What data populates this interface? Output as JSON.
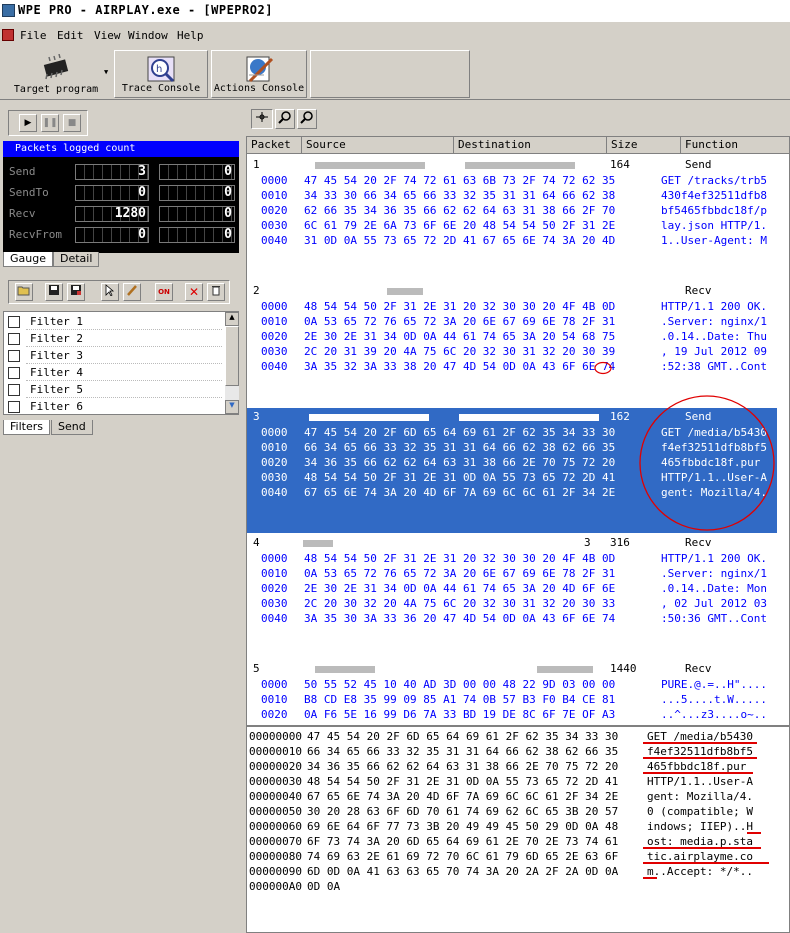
{
  "window": {
    "title": "WPE PRO - AIRPLAY.exe - [WPEPRO2]"
  },
  "menu": [
    "File",
    "Edit",
    "View",
    "Window",
    "Help"
  ],
  "toolbar": {
    "target_label": "Target program",
    "trace_label": "Trace Console",
    "actions_label": "Actions Console"
  },
  "stats": {
    "title": "Packets logged count",
    "rows": [
      {
        "label": "Send",
        "a": "3",
        "b": "0"
      },
      {
        "label": "SendTo",
        "a": "0",
        "b": "0"
      },
      {
        "label": "Recv",
        "a": "1280",
        "b": "0"
      },
      {
        "label": "RecvFrom",
        "a": "0",
        "b": "0"
      }
    ]
  },
  "tabs_top": [
    "Gauge",
    "Detail"
  ],
  "filters": [
    "Filter 1",
    "Filter 2",
    "Filter 3",
    "Filter 4",
    "Filter 5",
    "Filter 6"
  ],
  "tabs_bottom": [
    "Filters",
    "Send"
  ],
  "columns": [
    "Packet",
    "Source",
    "Destination",
    "Size",
    "Function"
  ],
  "packets": [
    {
      "num": "1",
      "size": "164",
      "func": "Send",
      "rows": [
        [
          "0000",
          "47 45 54 20 2F 74 72 61 63 6B 73 2F 74 72 62 35",
          "GET /tracks/trb5"
        ],
        [
          "0010",
          "34 33 30 66 34 65 66 33 32 35 31 31 64 66 62 38",
          "430f4ef32511dfb8"
        ],
        [
          "0020",
          "62 66 35 34 36 35 66 62 62 64 63 31 38 66 2F 70",
          "bf5465fbbdc18f/p"
        ],
        [
          "0030",
          "6C 61 79 2E 6A 73 6F 6E 20 48 54 54 50 2F 31 2E",
          "lay.json HTTP/1."
        ],
        [
          "0040",
          "31 0D 0A 55 73 65 72 2D 41 67 65 6E 74 3A 20 4D",
          "1..User-Agent: M"
        ]
      ]
    },
    {
      "num": "2",
      "size": "",
      "func": "Recv",
      "rows": [
        [
          "0000",
          "48 54 54 50 2F 31 2E 31 20 32 30 30 20 4F 4B 0D",
          "HTTP/1.1 200 OK."
        ],
        [
          "0010",
          "0A 53 65 72 76 65 72 3A 20 6E 67 69 6E 78 2F 31",
          ".Server: nginx/1"
        ],
        [
          "0020",
          "2E 30 2E 31 34 0D 0A 44 61 74 65 3A 20 54 68 75",
          ".0.14..Date: Thu"
        ],
        [
          "0030",
          "2C 20 31 39 20 4A 75 6C 20 32 30 31 32 20 30 39",
          ", 19 Jul 2012 09"
        ],
        [
          "0040",
          "3A 35 32 3A 33 38 20 47 4D 54 0D 0A 43 6F 6E 74",
          ":52:38 GMT..Cont"
        ]
      ]
    },
    {
      "num": "3",
      "size": "162",
      "func": "Send",
      "selected": true,
      "rows": [
        [
          "0000",
          "47 45 54 20 2F 6D 65 64 69 61 2F 62 35 34 33 30",
          "GET /media/b5430"
        ],
        [
          "0010",
          "66 34 65 66 33 32 35 31 31 64 66 62 38 62 66 35",
          "f4ef32511dfb8bf5"
        ],
        [
          "0020",
          "34 36 35 66 62 62 64 63 31 38 66 2E 70 75 72 20",
          "465fbbdc18f.pur "
        ],
        [
          "0030",
          "48 54 54 50 2F 31 2E 31 0D 0A 55 73 65 72 2D 41",
          "HTTP/1.1..User-A"
        ],
        [
          "0040",
          "67 65 6E 74 3A 20 4D 6F 7A 69 6C 6C 61 2F 34 2E",
          "gent: Mozilla/4."
        ]
      ]
    },
    {
      "num": "4",
      "size": "316",
      "func": "Recv",
      "size_prefix": "3",
      "rows": [
        [
          "0000",
          "48 54 54 50 2F 31 2E 31 20 32 30 30 20 4F 4B 0D",
          "HTTP/1.1 200 OK."
        ],
        [
          "0010",
          "0A 53 65 72 76 65 72 3A 20 6E 67 69 6E 78 2F 31",
          ".Server: nginx/1"
        ],
        [
          "0020",
          "2E 30 2E 31 34 0D 0A 44 61 74 65 3A 20 4D 6F 6E",
          ".0.14..Date: Mon"
        ],
        [
          "0030",
          "2C 20 30 32 20 4A 75 6C 20 32 30 31 32 20 30 33",
          ", 02 Jul 2012 03"
        ],
        [
          "0040",
          "3A 35 30 3A 33 36 20 47 4D 54 0D 0A 43 6F 6E 74",
          ":50:36 GMT..Cont"
        ]
      ]
    },
    {
      "num": "5",
      "size": "1440",
      "func": "Recv",
      "rows": [
        [
          "0000",
          "50 55 52 45 10 40 AD 3D 00 00 48 22 9D 03 00 00",
          "PURE.@.=..H\"...."
        ],
        [
          "0010",
          "B8 CD E8 35 99 09 85 A1 74 0B 57 B3 F0 B4 CE 81",
          "...5....t.W....."
        ],
        [
          "0020",
          "0A F6 5E 16 99 D6 7A 33 BD 19 DE 8C 6F 7E OF A3",
          "..^...z3....o~.."
        ]
      ]
    }
  ],
  "dump": [
    [
      "00000000",
      "47 45 54 20 2F 6D 65 64 69 61 2F 62 35 34 33 30",
      "GET /media/b5430"
    ],
    [
      "00000010",
      "66 34 65 66 33 32 35 31 31 64 66 62 38 62 66 35",
      "f4ef32511dfb8bf5"
    ],
    [
      "00000020",
      "34 36 35 66 62 62 64 63 31 38 66 2E 70 75 72 20",
      "465fbbdc18f.pur "
    ],
    [
      "00000030",
      "48 54 54 50 2F 31 2E 31 0D 0A 55 73 65 72 2D 41",
      "HTTP/1.1..User-A"
    ],
    [
      "00000040",
      "67 65 6E 74 3A 20 4D 6F 7A 69 6C 6C 61 2F 34 2E",
      "gent: Mozilla/4."
    ],
    [
      "00000050",
      "30 20 28 63 6F 6D 70 61 74 69 62 6C 65 3B 20 57",
      "0 (compatible; W"
    ],
    [
      "00000060",
      "69 6E 64 6F 77 73 3B 20 49 49 45 50 29 0D 0A 48",
      "indows; IIEP)..H"
    ],
    [
      "00000070",
      "6F 73 74 3A 20 6D 65 64 69 61 2E 70 2E 73 74 61",
      "ost: media.p.sta"
    ],
    [
      "00000080",
      "74 69 63 2E 61 69 72 70 6C 61 79 6D 65 2E 63 6F",
      "tic.airplayme.co"
    ],
    [
      "00000090",
      "6D 0D 0A 41 63 63 65 70 74 3A 20 2A 2F 2A 0D 0A",
      "m..Accept: */*.."
    ],
    [
      "000000A0",
      "0D 0A",
      ""
    ]
  ],
  "colors": {
    "selection": "#316ac5",
    "hex_text": "#0000ff",
    "annotation": "#e00000",
    "face": "#d4d0c8"
  },
  "icons": [
    "app-icon",
    "chip-icon",
    "trace-icon",
    "actions-icon",
    "play-icon",
    "pause-icon",
    "stop-icon",
    "open-icon",
    "save-icon",
    "save-as-icon",
    "cursor-icon",
    "edit-icon",
    "on-icon",
    "delete-icon",
    "trash-icon",
    "filter-zoom-icon",
    "search-icon"
  ]
}
